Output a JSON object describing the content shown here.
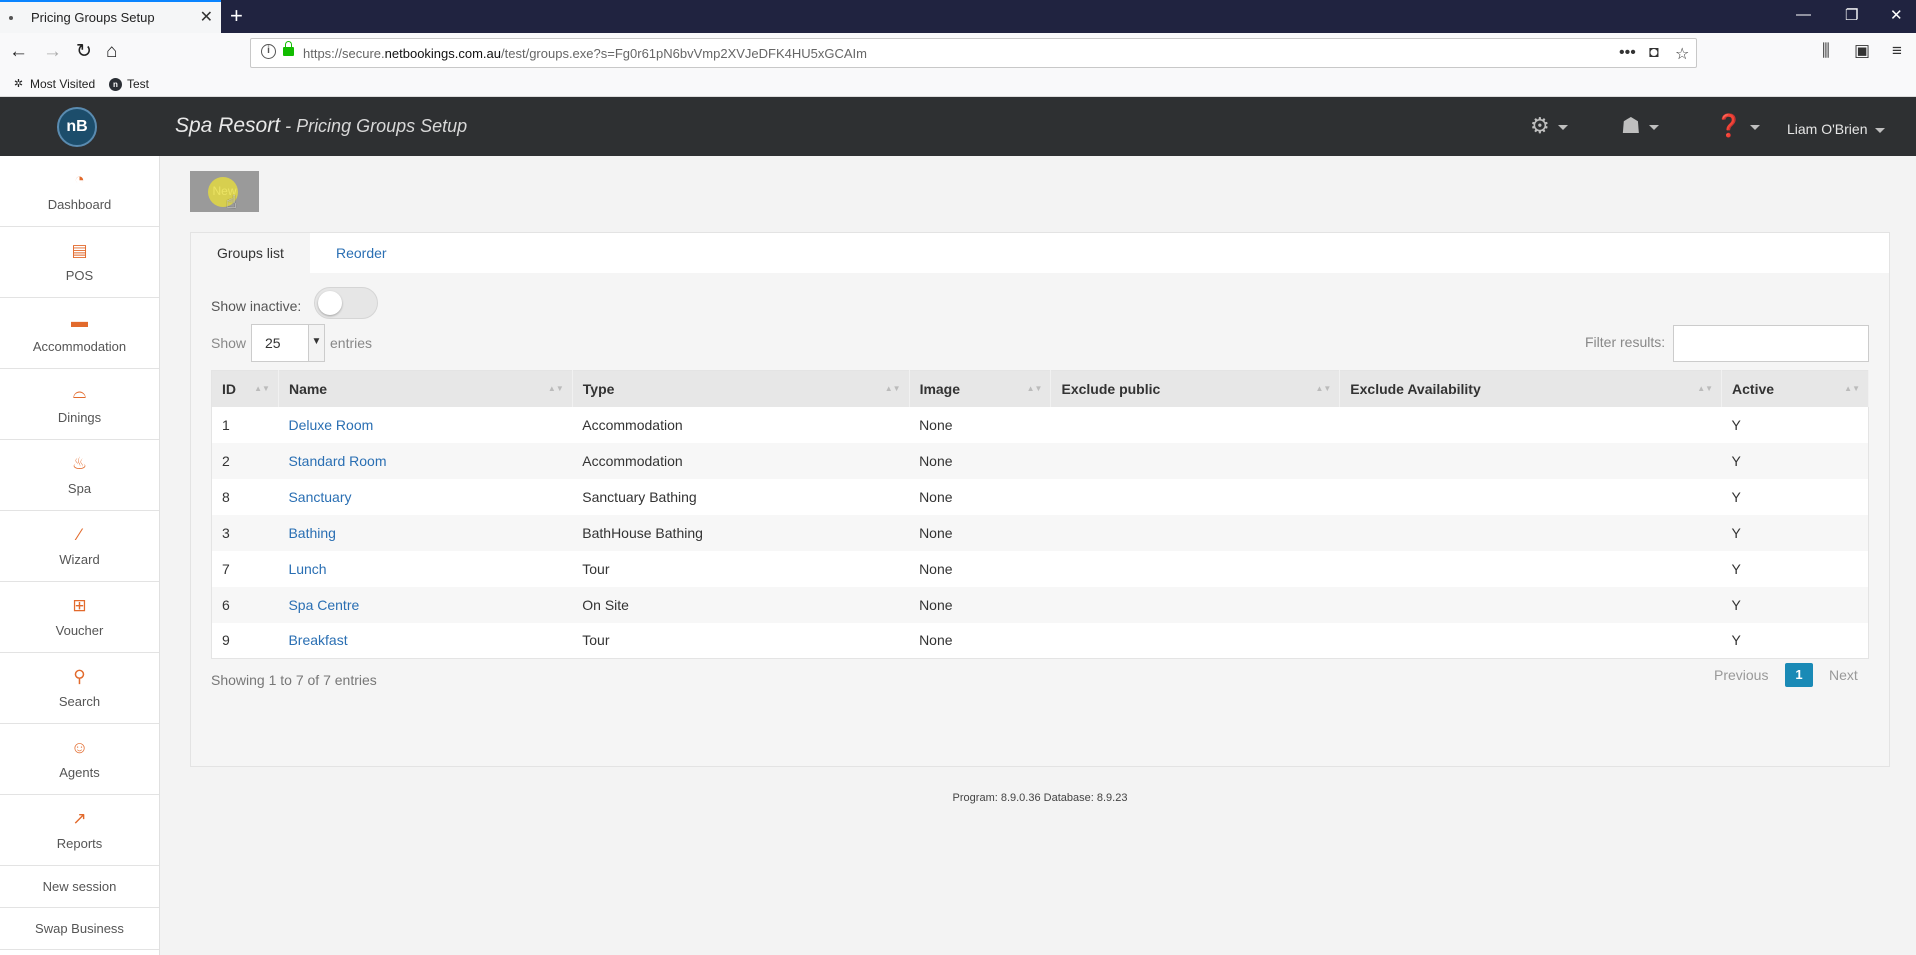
{
  "browser": {
    "tab_title": "Pricing Groups Setup",
    "tab_close": "✕",
    "new_tab": "+",
    "url_host": "https://secure.",
    "url_domain": "netbookings.com.au",
    "url_path": "/test/groups.exe?s=Fg0r61pN6bvVmp2XVJeDFK4HU5xGCAIm",
    "bookmarks": [
      "Most Visited",
      "Test"
    ]
  },
  "app": {
    "business": "Spa Resort",
    "separator": " - ",
    "page": "Pricing Groups Setup",
    "logo": "nB",
    "user": "Liam O'Brien"
  },
  "sidebar": {
    "items": [
      {
        "label": "Dashboard",
        "icon": "dashboard-icon"
      },
      {
        "label": "POS",
        "icon": "pos-icon"
      },
      {
        "label": "Accommodation",
        "icon": "bed-icon"
      },
      {
        "label": "Dinings",
        "icon": "dining-icon"
      },
      {
        "label": "Spa",
        "icon": "spa-icon"
      },
      {
        "label": "Wizard",
        "icon": "wand-icon"
      },
      {
        "label": "Voucher",
        "icon": "gift-icon"
      },
      {
        "label": "Search",
        "icon": "search-icon"
      },
      {
        "label": "Agents",
        "icon": "agent-icon"
      },
      {
        "label": "Reports",
        "icon": "chart-icon"
      }
    ],
    "links": [
      "New session",
      "Swap Business"
    ]
  },
  "toolbar": {
    "new_label": "New"
  },
  "tabs": [
    "Groups list",
    "Reorder"
  ],
  "controls": {
    "show_inactive": "Show inactive:",
    "show": "Show",
    "entries_value": "25",
    "entries": "entries",
    "filter_label": "Filter results:",
    "filter_value": ""
  },
  "table": {
    "columns": [
      "ID",
      "Name",
      "Type",
      "Image",
      "Exclude public",
      "Exclude Availability",
      "Active"
    ],
    "rows": [
      {
        "id": "1",
        "name": "Deluxe Room",
        "type": "Accommodation",
        "image": "None",
        "exclude_public": "",
        "exclude_availability": "",
        "active": "Y"
      },
      {
        "id": "2",
        "name": "Standard Room",
        "type": "Accommodation",
        "image": "None",
        "exclude_public": "",
        "exclude_availability": "",
        "active": "Y"
      },
      {
        "id": "8",
        "name": "Sanctuary",
        "type": "Sanctuary Bathing",
        "image": "None",
        "exclude_public": "",
        "exclude_availability": "",
        "active": "Y"
      },
      {
        "id": "3",
        "name": "Bathing",
        "type": "BathHouse Bathing",
        "image": "None",
        "exclude_public": "",
        "exclude_availability": "",
        "active": "Y"
      },
      {
        "id": "7",
        "name": "Lunch",
        "type": "Tour",
        "image": "None",
        "exclude_public": "",
        "exclude_availability": "",
        "active": "Y"
      },
      {
        "id": "6",
        "name": "Spa Centre",
        "type": "On Site",
        "image": "None",
        "exclude_public": "",
        "exclude_availability": "",
        "active": "Y"
      },
      {
        "id": "9",
        "name": "Breakfast",
        "type": "Tour",
        "image": "None",
        "exclude_public": "",
        "exclude_availability": "",
        "active": "Y"
      }
    ]
  },
  "pagination": {
    "info": "Showing 1 to 7 of 7 entries",
    "previous": "Previous",
    "current": "1",
    "next": "Next"
  },
  "footer": {
    "version": "Program: 8.9.0.36 Database: 8.9.23"
  },
  "colors": {
    "accent": "#1a8ab6",
    "sidebar_icon": "#e26a2c",
    "link": "#2a6fb3",
    "header_bg": "#2e3032"
  }
}
